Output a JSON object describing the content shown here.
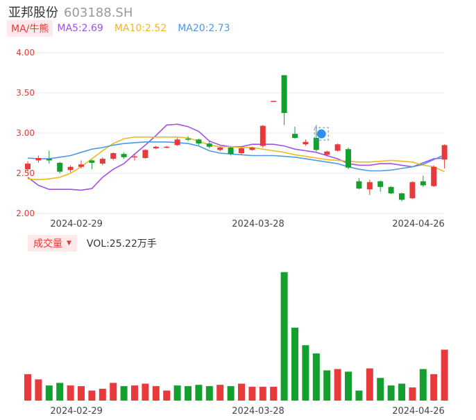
{
  "header": {
    "name": "亚邦股份",
    "code": "603188.SH"
  },
  "ma_legend": {
    "badge": "MA/牛熊",
    "ma5": "MA5:2.69",
    "ma10": "MA10:2.52",
    "ma20": "MA20:2.73"
  },
  "vol_legend": {
    "badge": "成交量",
    "text": "VOL:25.22万手"
  },
  "colors": {
    "up": "#e83a3a",
    "down": "#14a02e",
    "ma5": "#a050e8",
    "ma10": "#f0b820",
    "ma20": "#4a98e8",
    "grid": "#e8e8e8"
  },
  "chart_data": [
    {
      "type": "candlestick",
      "title": "",
      "ylim": [
        2.0,
        4.0
      ],
      "y_ticks": [
        "4.00",
        "3.50",
        "3.00",
        "2.50",
        "2.00"
      ],
      "x_tick_labels": [
        {
          "index": 3,
          "label": "2024-02-29"
        },
        {
          "index": 20,
          "label": "2024-03-28"
        },
        {
          "index": 35,
          "label": "2024-04-26"
        }
      ],
      "grid": true,
      "candles": [
        {
          "o": 2.55,
          "c": 2.62,
          "h": 2.65,
          "l": 2.52
        },
        {
          "o": 2.66,
          "c": 2.69,
          "h": 2.72,
          "l": 2.63
        },
        {
          "o": 2.68,
          "c": 2.66,
          "h": 2.78,
          "l": 2.62
        },
        {
          "o": 2.63,
          "c": 2.52,
          "h": 2.64,
          "l": 2.5
        },
        {
          "o": 2.54,
          "c": 2.58,
          "h": 2.6,
          "l": 2.51
        },
        {
          "o": 2.58,
          "c": 2.61,
          "h": 2.66,
          "l": 2.56
        },
        {
          "o": 2.66,
          "c": 2.63,
          "h": 2.67,
          "l": 2.55
        },
        {
          "o": 2.62,
          "c": 2.68,
          "h": 2.7,
          "l": 2.6
        },
        {
          "o": 2.68,
          "c": 2.75,
          "h": 2.76,
          "l": 2.66
        },
        {
          "o": 2.74,
          "c": 2.7,
          "h": 2.76,
          "l": 2.68
        },
        {
          "o": 2.7,
          "c": 2.71,
          "h": 2.74,
          "l": 2.66
        },
        {
          "o": 2.69,
          "c": 2.79,
          "h": 2.8,
          "l": 2.68
        },
        {
          "o": 2.81,
          "c": 2.83,
          "h": 2.84,
          "l": 2.8
        },
        {
          "o": 2.82,
          "c": 2.83,
          "h": 2.84,
          "l": 2.81
        },
        {
          "o": 2.85,
          "c": 2.92,
          "h": 2.94,
          "l": 2.84
        },
        {
          "o": 2.93,
          "c": 2.92,
          "h": 2.96,
          "l": 2.9
        },
        {
          "o": 2.92,
          "c": 2.87,
          "h": 2.93,
          "l": 2.85
        },
        {
          "o": 2.87,
          "c": 2.83,
          "h": 2.9,
          "l": 2.81
        },
        {
          "o": 2.79,
          "c": 2.82,
          "h": 2.83,
          "l": 2.77
        },
        {
          "o": 2.82,
          "c": 2.74,
          "h": 2.83,
          "l": 2.72
        },
        {
          "o": 2.75,
          "c": 2.81,
          "h": 2.82,
          "l": 2.73
        },
        {
          "o": 2.79,
          "c": 2.82,
          "h": 2.83,
          "l": 2.78
        },
        {
          "o": 2.84,
          "c": 3.09,
          "h": 3.1,
          "l": 2.82
        },
        {
          "o": 3.4,
          "c": 3.4,
          "h": 3.4,
          "l": 3.4
        },
        {
          "o": 3.72,
          "c": 3.25,
          "h": 3.72,
          "l": 3.1
        },
        {
          "o": 2.99,
          "c": 2.94,
          "h": 3.08,
          "l": 2.93
        },
        {
          "o": 2.86,
          "c": 2.89,
          "h": 2.92,
          "l": 2.84
        },
        {
          "o": 2.94,
          "c": 2.79,
          "h": 3.1,
          "l": 2.77
        },
        {
          "o": 2.73,
          "c": 2.77,
          "h": 2.78,
          "l": 2.71
        },
        {
          "o": 2.78,
          "c": 2.86,
          "h": 2.87,
          "l": 2.77
        },
        {
          "o": 2.8,
          "c": 2.57,
          "h": 2.82,
          "l": 2.55
        },
        {
          "o": 2.4,
          "c": 2.31,
          "h": 2.44,
          "l": 2.3
        },
        {
          "o": 2.3,
          "c": 2.39,
          "h": 2.42,
          "l": 2.23
        },
        {
          "o": 2.4,
          "c": 2.33,
          "h": 2.41,
          "l": 2.27
        },
        {
          "o": 2.33,
          "c": 2.25,
          "h": 2.34,
          "l": 2.24
        },
        {
          "o": 2.25,
          "c": 2.17,
          "h": 2.26,
          "l": 2.15
        },
        {
          "o": 2.19,
          "c": 2.39,
          "h": 2.4,
          "l": 2.18
        },
        {
          "o": 2.4,
          "c": 2.35,
          "h": 2.47,
          "l": 2.33
        },
        {
          "o": 2.34,
          "c": 2.58,
          "h": 2.6,
          "l": 2.33
        },
        {
          "o": 2.67,
          "c": 2.85,
          "h": 2.86,
          "l": 2.56
        }
      ],
      "series": [
        {
          "name": "MA5",
          "color_key": "ma5",
          "values": [
            2.45,
            2.35,
            2.3,
            2.3,
            2.3,
            2.29,
            2.31,
            2.45,
            2.55,
            2.62,
            2.74,
            2.85,
            2.97,
            3.1,
            3.11,
            3.08,
            3.02,
            2.9,
            2.85,
            2.83,
            2.83,
            2.86,
            2.86,
            2.86,
            2.84,
            2.8,
            2.78,
            2.76,
            2.72,
            2.68,
            2.62,
            2.6,
            2.6,
            2.62,
            2.62,
            2.6,
            2.58,
            2.63,
            2.68,
            2.69
          ]
        },
        {
          "name": "MA10",
          "color_key": "ma10",
          "values": [
            2.43,
            2.42,
            2.43,
            2.45,
            2.5,
            2.58,
            2.68,
            2.78,
            2.87,
            2.93,
            2.95,
            2.95,
            2.95,
            2.95,
            2.95,
            2.94,
            2.9,
            2.85,
            2.83,
            2.83,
            2.82,
            2.82,
            2.8,
            2.78,
            2.76,
            2.73,
            2.71,
            2.69,
            2.67,
            2.66,
            2.65,
            2.64,
            2.64,
            2.65,
            2.66,
            2.65,
            2.64,
            2.6,
            2.58,
            2.52
          ]
        },
        {
          "name": "MA20",
          "color_key": "ma20",
          "values": [
            2.69,
            2.68,
            2.68,
            2.7,
            2.72,
            2.76,
            2.8,
            2.82,
            2.85,
            2.87,
            2.88,
            2.89,
            2.89,
            2.89,
            2.88,
            2.87,
            2.84,
            2.78,
            2.75,
            2.74,
            2.73,
            2.72,
            2.72,
            2.72,
            2.71,
            2.7,
            2.68,
            2.66,
            2.64,
            2.62,
            2.58,
            2.55,
            2.53,
            2.53,
            2.54,
            2.56,
            2.58,
            2.61,
            2.67,
            2.73
          ]
        }
      ]
    },
    {
      "type": "bar",
      "title": "",
      "x_tick_labels": [
        {
          "index": 3,
          "label": "2024-02-29"
        },
        {
          "index": 20,
          "label": "2024-03-28"
        },
        {
          "index": 35,
          "label": "2024-04-26"
        }
      ],
      "ylim": [
        0,
        100
      ],
      "values": [
        20.3,
        16.3,
        11.6,
        13.6,
        11.6,
        11.1,
        7.7,
        9.1,
        13.6,
        11.1,
        11.6,
        13.0,
        11.1,
        7.7,
        11.6,
        11.1,
        12.1,
        11.1,
        12.1,
        11.1,
        13.0,
        10.6,
        10.6,
        10.6,
        98.6,
        56.0,
        42.5,
        36.2,
        23.2,
        24.2,
        22.2,
        7.7,
        24.7,
        17.4,
        11.6,
        13.0,
        10.1,
        24.2,
        20.3,
        39.1
      ],
      "directions": [
        "up",
        "up",
        "down",
        "down",
        "up",
        "up",
        "up",
        "up",
        "up",
        "down",
        "up",
        "up",
        "up",
        "up",
        "down",
        "down",
        "down",
        "down",
        "up",
        "down",
        "up",
        "up",
        "up",
        "up",
        "down",
        "down",
        "down",
        "down",
        "down",
        "up",
        "down",
        "down",
        "up",
        "down",
        "down",
        "down",
        "up",
        "down",
        "up",
        "up"
      ]
    }
  ]
}
